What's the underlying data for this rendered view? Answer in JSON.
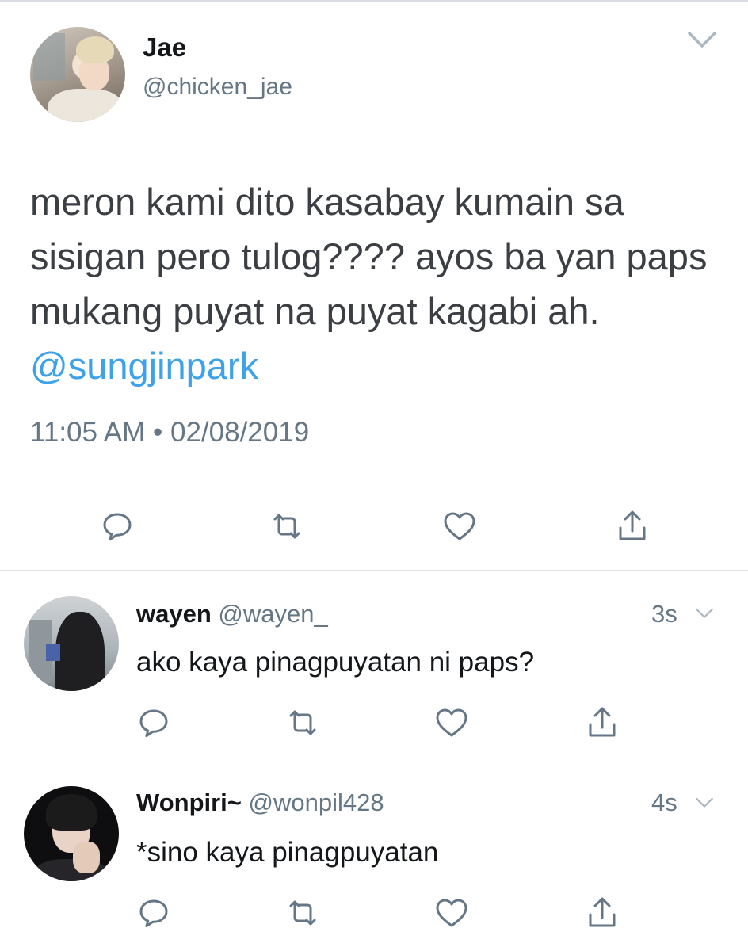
{
  "tweet": {
    "name": "Jae",
    "handle": "@chicken_jae",
    "text": "meron kami dito kasabay kumain sa sisigan pero tulog???? ayos ba yan paps mukang puyat na puyat kagabi ah. ",
    "mention": "@sungjinpark",
    "timestamp": "11:05 AM • 02/08/2019",
    "menu_icon": "chevron-down-icon",
    "actions": [
      "reply-icon",
      "retweet-icon",
      "like-icon",
      "share-icon"
    ]
  },
  "replies": [
    {
      "name": "wayen",
      "handle": "@wayen_",
      "time": "3s",
      "text": "ako kaya pinagpuyatan ni paps?"
    },
    {
      "name": "Wonpiri~",
      "handle": "@wonpil428",
      "time": "4s",
      "text": "*sino kaya pinagpuyatan"
    }
  ],
  "colors": {
    "mention": "#3ea2e9",
    "secondary_text": "#657786",
    "icon": "#657786",
    "divider": "#dfe3e6"
  }
}
